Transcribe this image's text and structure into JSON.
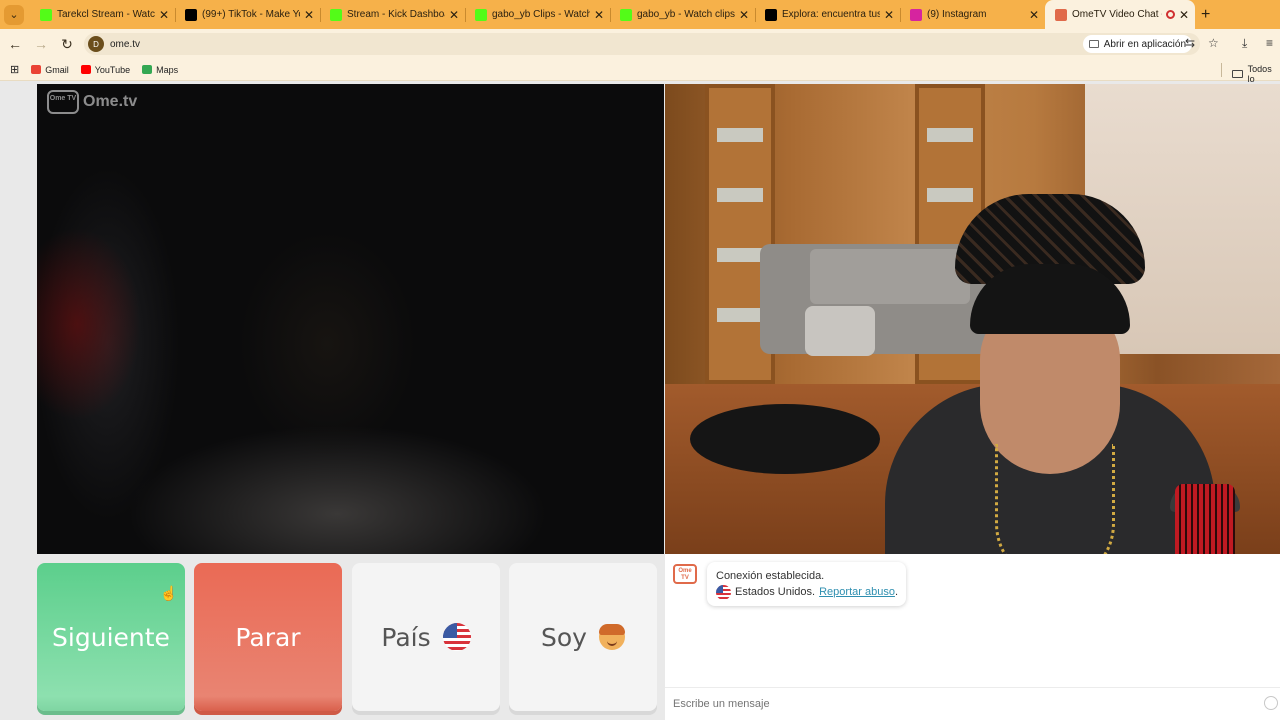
{
  "browser": {
    "tabs": [
      {
        "title": "Tarekcl Stream - Watch Li",
        "icon": "kick-icon",
        "color": "#53fc18"
      },
      {
        "title": "(99+) TikTok - Make Your",
        "icon": "tiktok-icon",
        "color": "#000000"
      },
      {
        "title": "Stream - Kick Dashboard",
        "icon": "kick-icon",
        "color": "#53fc18"
      },
      {
        "title": "gabo_yb Clips - Watch Li",
        "icon": "kick-icon",
        "color": "#53fc18"
      },
      {
        "title": "gabo_yb - Watch clips on",
        "icon": "kick-icon",
        "color": "#53fc18"
      },
      {
        "title": "Explora: encuentra tus vid",
        "icon": "tiktok-icon",
        "color": "#000000"
      },
      {
        "title": "(9) Instagram",
        "icon": "instagram-icon",
        "color": "#d6249f"
      },
      {
        "title": "OmeTV Video Chat -",
        "icon": "ometv-icon",
        "color": "#e06a4a",
        "active": true
      }
    ],
    "url": "ome.tv",
    "open_in_app": "Abrir en aplicación",
    "bookmarks": [
      {
        "label": "Gmail",
        "color": "#ea4335"
      },
      {
        "label": "YouTube",
        "color": "#ff0000"
      },
      {
        "label": "Maps",
        "color": "#34a853"
      }
    ],
    "all_bookmarks": "Todos lo"
  },
  "app": {
    "logo_text": "Ome.tv",
    "logo_icon_text": "Ome TV",
    "buttons": {
      "next": "Siguiente",
      "stop": "Parar",
      "country": "País",
      "gender": "Soy"
    },
    "chat": {
      "status": "Conexión establecida.",
      "country": "Estados Unidos.",
      "report": "Reportar abuso",
      "report_suffix": ".",
      "input_placeholder": "Escribe un mensaje"
    }
  }
}
